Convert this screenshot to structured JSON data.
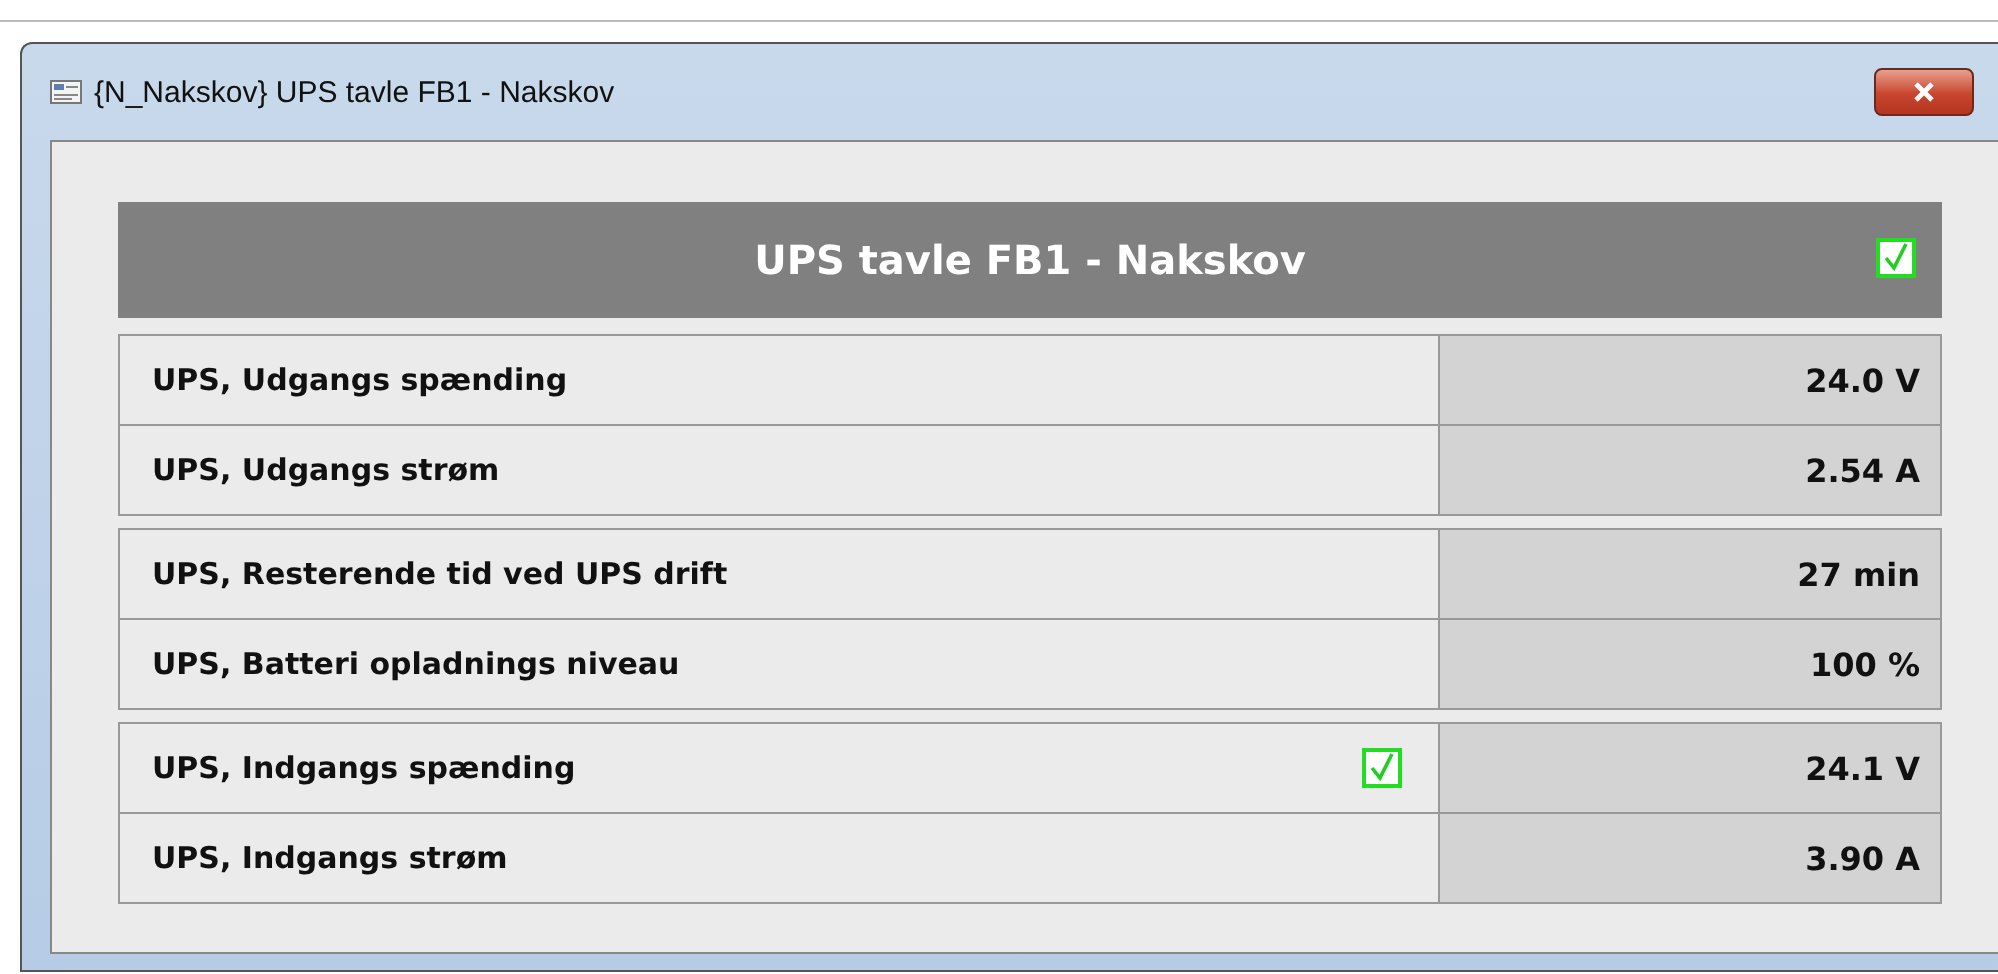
{
  "window": {
    "title": "{N_Nakskov} UPS tavle FB1 - Nakskov"
  },
  "panel": {
    "title": "UPS tavle FB1 - Nakskov",
    "ok": true
  },
  "groups": [
    {
      "rows": [
        {
          "label": "UPS, Udgangs spænding",
          "value": "24.0 V",
          "ok": false
        },
        {
          "label": "UPS, Udgangs strøm",
          "value": "2.54 A",
          "ok": false
        }
      ]
    },
    {
      "rows": [
        {
          "label": "UPS, Resterende tid ved UPS drift",
          "value": "27 min",
          "ok": false
        },
        {
          "label": "UPS, Batteri opladnings niveau",
          "value": "100 %",
          "ok": false
        }
      ]
    },
    {
      "rows": [
        {
          "label": "UPS, Indgangs spænding",
          "value": "24.1 V",
          "ok": true
        },
        {
          "label": "UPS, Indgangs strøm",
          "value": "3.90 A",
          "ok": false
        }
      ]
    }
  ]
}
